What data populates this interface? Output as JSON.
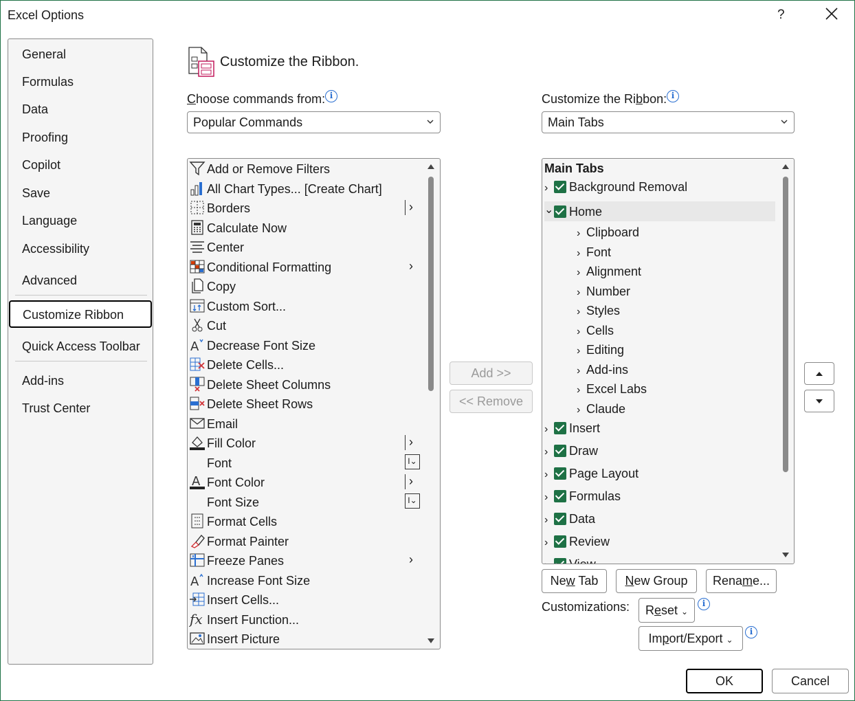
{
  "window": {
    "title": "Excel Options",
    "help": "?"
  },
  "nav": {
    "items": [
      "General",
      "Formulas",
      "Data",
      "Proofing",
      "Copilot",
      "Save",
      "Language",
      "Accessibility",
      "Advanced"
    ],
    "selected": "Customize Ribbon",
    "items2": [
      "Quick Access Toolbar"
    ],
    "items3": [
      "Add-ins",
      "Trust Center"
    ]
  },
  "heading": "Customize the Ribbon.",
  "left": {
    "label": "Choose commands from:",
    "combo_value": "Popular Commands",
    "commands": [
      {
        "label": "Add or Remove Filters",
        "icon": "filter-icon"
      },
      {
        "label": "All Chart Types... [Create Chart]",
        "icon": "chart-icon"
      },
      {
        "label": "Borders",
        "icon": "borders-icon",
        "extra": "split"
      },
      {
        "label": "Calculate Now",
        "icon": "calculator-icon"
      },
      {
        "label": "Center",
        "icon": "align-center-icon"
      },
      {
        "label": "Conditional Formatting",
        "icon": "conditional-formatting-icon",
        "extra": "arrow"
      },
      {
        "label": "Copy",
        "icon": "copy-icon"
      },
      {
        "label": "Custom Sort...",
        "icon": "sort-icon"
      },
      {
        "label": "Cut",
        "icon": "scissors-icon"
      },
      {
        "label": "Decrease Font Size",
        "icon": "decrease-font-icon"
      },
      {
        "label": "Delete Cells...",
        "icon": "delete-cells-icon"
      },
      {
        "label": "Delete Sheet Columns",
        "icon": "delete-columns-icon"
      },
      {
        "label": "Delete Sheet Rows",
        "icon": "delete-rows-icon"
      },
      {
        "label": "Email",
        "icon": "email-icon"
      },
      {
        "label": "Fill Color",
        "icon": "fill-color-icon",
        "extra": "split"
      },
      {
        "label": "Font",
        "icon": "",
        "extra": "fbox"
      },
      {
        "label": "Font Color",
        "icon": "font-color-icon",
        "extra": "split"
      },
      {
        "label": "Font Size",
        "icon": "",
        "extra": "fbox"
      },
      {
        "label": "Format Cells",
        "icon": "format-cells-icon"
      },
      {
        "label": "Format Painter",
        "icon": "format-painter-icon"
      },
      {
        "label": "Freeze Panes",
        "icon": "freeze-panes-icon",
        "extra": "arrow"
      },
      {
        "label": "Increase Font Size",
        "icon": "increase-font-icon"
      },
      {
        "label": "Insert Cells...",
        "icon": "insert-cells-icon"
      },
      {
        "label": "Insert Function...",
        "icon": "function-icon"
      },
      {
        "label": "Insert Picture",
        "icon": "picture-icon"
      }
    ]
  },
  "middle": {
    "add": "Add >>",
    "remove": "<< Remove"
  },
  "right": {
    "label": "Customize the Ribbon:",
    "combo_value": "Main Tabs",
    "tree_header": "Main Tabs",
    "tabs_top": [
      {
        "label": "Background Removal",
        "expanded": false
      },
      {
        "label": "Home",
        "expanded": true
      }
    ],
    "home_groups": [
      "Clipboard",
      "Font",
      "Alignment",
      "Number",
      "Styles",
      "Cells",
      "Editing",
      "Add-ins",
      "Excel Labs",
      "Claude"
    ],
    "tabs_bottom": [
      "Insert",
      "Draw",
      "Page Layout",
      "Formulas",
      "Data",
      "Review"
    ],
    "partial": "View",
    "buttons": {
      "new_tab": "New Tab",
      "new_group": "New Group",
      "rename": "Rename..."
    },
    "customizations_label": "Customizations:",
    "reset": "Reset",
    "import_export": "Import/Export"
  },
  "footer": {
    "ok": "OK",
    "cancel": "Cancel"
  },
  "colors": {
    "accent": "#1e7145",
    "info": "#2a6fd1"
  }
}
